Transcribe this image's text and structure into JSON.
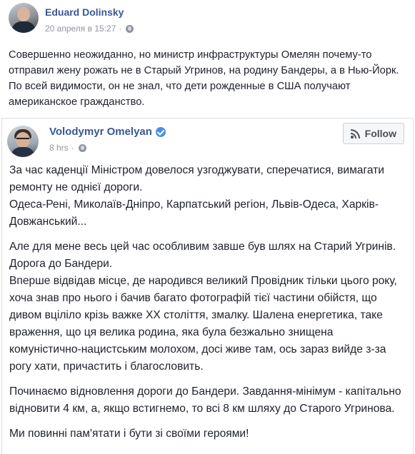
{
  "outer_post": {
    "author": "Eduard Dolinsky",
    "date": "20 апреля в 15:27",
    "separator": "·",
    "privacy_icon": "globe-icon",
    "text": "Совершенно неожиданно, но министр инфраструктуры Омелян почему-то отправил жену рожать не в Старый Угринов, на родину Бандеры, а в Нью-Йорк. По всей видимости, он не знал, что дети рожденные в США получают американское гражданство."
  },
  "shared_post": {
    "author": "Volodymyr Omelyan",
    "verified_icon": "verified-badge-icon",
    "time": "8 hrs",
    "separator": "·",
    "privacy_icon": "globe-icon",
    "follow_label": "Follow",
    "follow_icon": "rss-icon",
    "paragraphs": [
      {
        "lines": [
          "За час каденції Міністром довелося узгоджувати, сперечатися, вимагати ремонту не однієї дороги.",
          "Одеса-Рені, Миколаїв-Дніпро, Карпатський регіон, Львів-Одеса, Харків-Довжанський..."
        ]
      },
      {
        "lines": [
          "Але для мене весь цей час особливим завше був шлях на Старий Угринів. Дорога до Бандери.",
          "Вперше відвідав місце, де народився великий Провідник тільки цього року, хоча знав про нього і бачив багато фотографій тієї частини обійстя, що дивом вціліло крізь важке ХХ століття, змалку. Шалена енергетика, таке враження, що ця велика родина, яка була безжально знищена комуністично-нацистським молохом, досі живе там, ось зараз вийде з-за рогу хати, причастить і благословить."
        ]
      },
      {
        "lines": [
          "Починаємо відновлення дороги до Бандери. Завдання-мінімум - капітально відновити 4 км, а, якщо встигнемо, то всі 8 км шляху до Старого Угринова."
        ]
      },
      {
        "lines": [
          "Ми повинні пам'ятати і бути зі своїми героями!"
        ]
      }
    ]
  },
  "colors": {
    "author_link": "#385898",
    "meta_gray": "#90949c",
    "text": "#1d2129",
    "border": "#dddfe2"
  }
}
